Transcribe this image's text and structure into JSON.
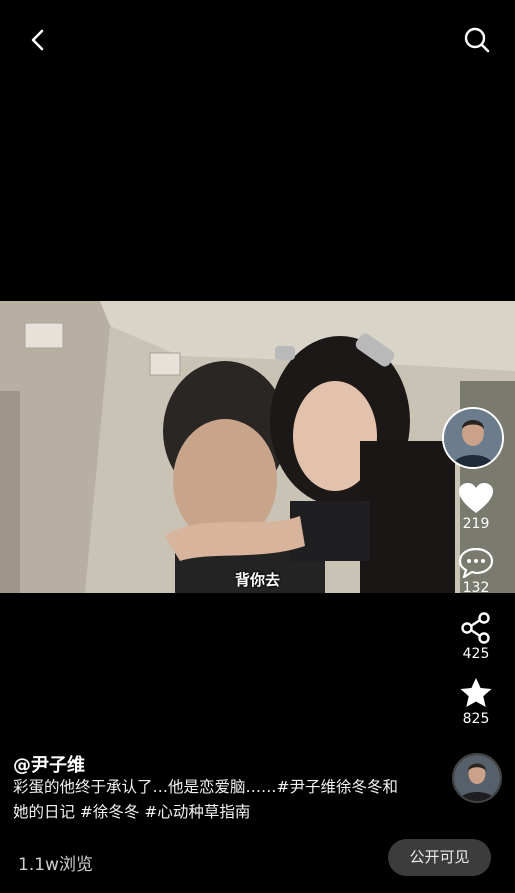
{
  "video": {
    "subtitle": "背你去"
  },
  "rail": {
    "likes": "219",
    "comments": "132",
    "shares": "425",
    "favorites": "825"
  },
  "post": {
    "author": "@尹子维",
    "caption": "彩蛋的他终于承认了…他是恋爱脑……#尹子维徐冬冬和她的日记 #徐冬冬 #心动种草指南",
    "views": "1.1w浏览",
    "visibility": "公开可见"
  },
  "icons": [
    "back-icon",
    "search-icon",
    "heart-icon",
    "comment-icon",
    "share-icon",
    "star-icon"
  ]
}
